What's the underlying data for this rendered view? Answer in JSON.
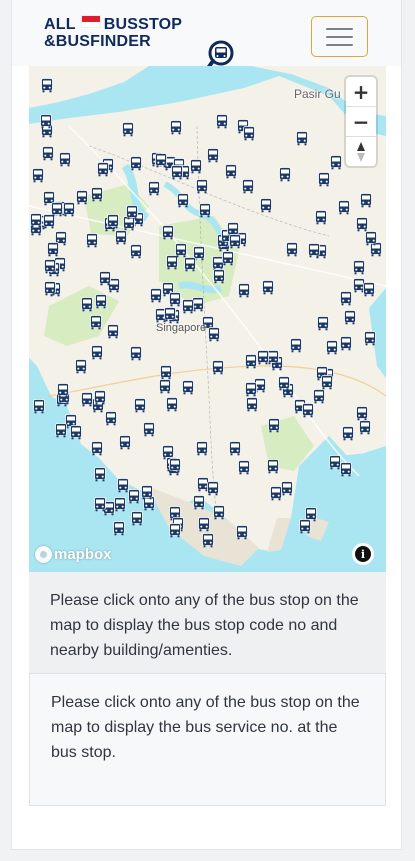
{
  "brand": {
    "line1_left": "ALL",
    "line1_right": "BUSSTOP",
    "line2": "&BUSFINDER"
  },
  "navbar": {
    "toggler_icon": "hamburger-menu-icon"
  },
  "map": {
    "provider": "mapbox",
    "city_label": "Singapore",
    "area_label": "Pasir Gu",
    "zoom_in": "+",
    "zoom_out": "−",
    "compass": "compass-icon",
    "attribution_icon": "i",
    "marker_icon": "bus-icon",
    "colors": {
      "sea": "#a9e6f2",
      "land": "#f4f1e8",
      "park": "#d8ecc2",
      "marker": "#1c3966"
    }
  },
  "panels": {
    "stop_info": "Please click onto any of the bus stop on the map to display the bus stop code no and nearby building/amenties.",
    "service_info": "Please click onto any of the bus stop on the map to display the bus service no. at the bus stop."
  }
}
